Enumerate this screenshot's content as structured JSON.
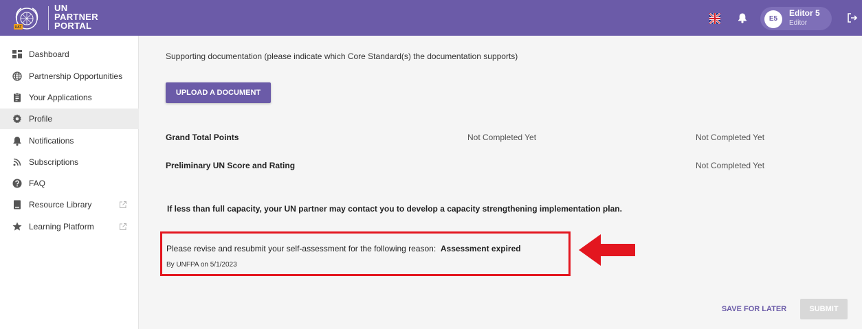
{
  "header": {
    "logo_lines": [
      "UN",
      "PARTNER",
      "PORTAL"
    ],
    "user_initials": "E5",
    "user_name": "Editor 5",
    "user_role": "Editor",
    "brand_color": "#6b5ba8"
  },
  "sidebar": {
    "items": [
      {
        "label": "Dashboard",
        "icon": "dashboard-icon"
      },
      {
        "label": "Partnership Opportunities",
        "icon": "globe-icon"
      },
      {
        "label": "Your Applications",
        "icon": "clipboard-icon"
      },
      {
        "label": "Profile",
        "icon": "gear-icon",
        "active": true
      },
      {
        "label": "Notifications",
        "icon": "bell-icon"
      },
      {
        "label": "Subscriptions",
        "icon": "rss-icon"
      },
      {
        "label": "FAQ",
        "icon": "help-icon"
      },
      {
        "label": "Resource Library",
        "icon": "book-icon",
        "external": true
      },
      {
        "label": "Learning Platform",
        "icon": "star-icon",
        "external": true
      }
    ]
  },
  "main": {
    "supporting_text": "Supporting documentation (please indicate which Core Standard(s) the documentation supports)",
    "upload_label": "UPLOAD A DOCUMENT",
    "grand_total_label": "Grand Total Points",
    "grand_total_value_1": "Not Completed Yet",
    "grand_total_value_2": "Not Completed Yet",
    "preliminary_label": "Preliminary UN Score and Rating",
    "preliminary_value": "Not Completed Yet",
    "capacity_text": "If less than full capacity, your UN partner may contact you to develop a capacity strengthening implementation plan.",
    "reason_prefix": "Please revise and resubmit your self-assessment for the following reason:",
    "reason_value": "Assessment expired",
    "reason_by": "By UNFPA on 5/1/2023",
    "save_label": "SAVE FOR LATER",
    "submit_label": "SUBMIT",
    "highlight_color": "#e3161f"
  }
}
